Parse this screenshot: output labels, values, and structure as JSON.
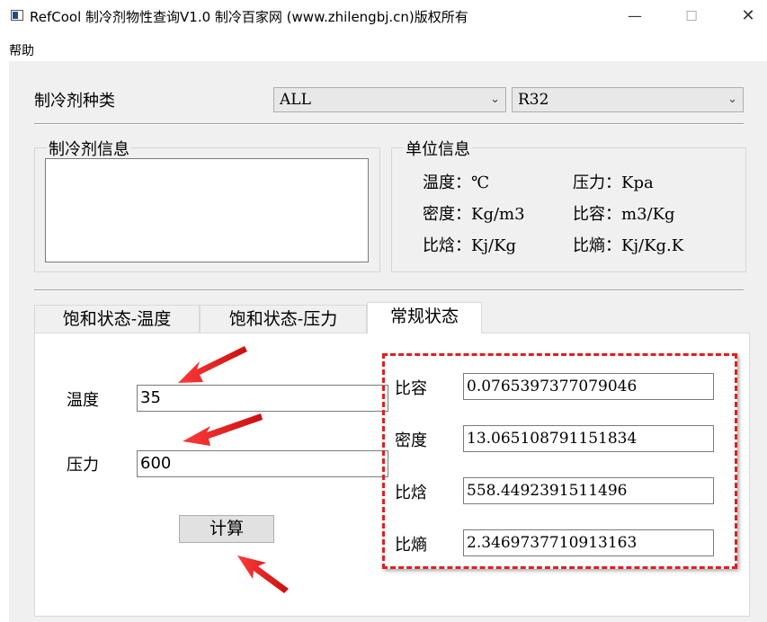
{
  "window": {
    "title": "RefCool 制冷剂物性查询V1.0  制冷百家网 (www.zhilengbj.cn)版权所有",
    "minimize_glyph": "—",
    "maximize_glyph": "☐",
    "close_glyph": "✕"
  },
  "menu": {
    "help": "帮助"
  },
  "refrigerant": {
    "type_label": "制冷剂种类",
    "category_value": "ALL",
    "refrigerant_value": "R32"
  },
  "info_group": {
    "title": "制冷剂信息",
    "text": ""
  },
  "units_group": {
    "title": "单位信息",
    "temperature": "温度：℃",
    "pressure": "压力：Kpa",
    "density": "密度：Kg/m3",
    "specific_volume": "比容：m3/Kg",
    "enthalpy": "比焓：Kj/Kg",
    "entropy": "比熵：Kj/Kg.K"
  },
  "tabs": [
    {
      "label": "饱和状态-温度"
    },
    {
      "label": "饱和状态-压力"
    },
    {
      "label": "常规状态"
    }
  ],
  "form": {
    "temperature_label": "温度",
    "temperature_value": "35",
    "pressure_label": "压力",
    "pressure_value": "600",
    "calculate_label": "计算"
  },
  "results": {
    "specific_volume_label": "比容",
    "specific_volume_value": "0.0765397377079046",
    "density_label": "密度",
    "density_value": "13.065108791151834",
    "enthalpy_label": "比焓",
    "enthalpy_value": "558.4492391511496",
    "entropy_label": "比熵",
    "entropy_value": "2.3469737710913163"
  },
  "colors": {
    "annotation": "#e02020",
    "background": "#f0f0f0"
  }
}
